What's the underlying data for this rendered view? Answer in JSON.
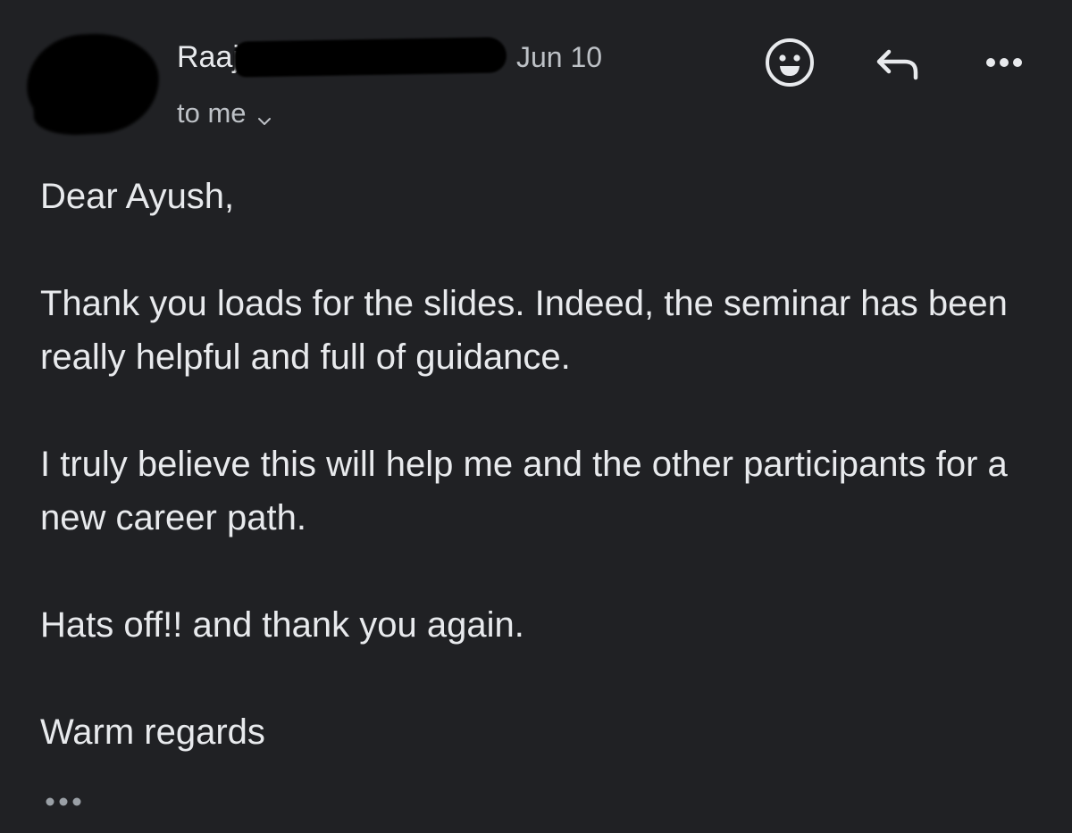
{
  "header": {
    "sender_name": "Raaj",
    "date": "Jun 10",
    "recipient": "to me",
    "icons": {
      "avatar": "avatar",
      "emoji_reaction": "smiley-face-icon",
      "reply": "reply-arrow-icon",
      "more": "more-options-icon",
      "recipient_toggle": "chevron-down-icon"
    }
  },
  "body": {
    "greeting": "Dear Ayush,",
    "paragraphs": [
      "Thank you loads for the slides. Indeed, the seminar has been really helpful and full of guidance.",
      "I truly believe this will help me and the other participants for a new career path.",
      "Hats off!! and thank you again.",
      "Warm regards"
    ]
  },
  "footer": {
    "trimmed_content_icon": "ellipsis-icon"
  },
  "colors": {
    "background": "#202124",
    "text_primary": "#e8eaed",
    "text_secondary": "#bdc1c6",
    "icon": "#e8eaed",
    "redaction": "#000000"
  }
}
